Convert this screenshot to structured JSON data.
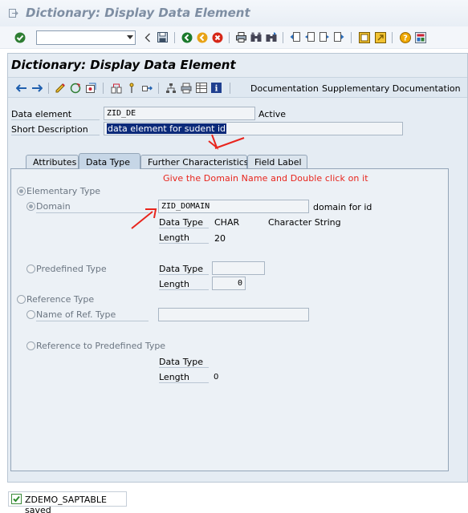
{
  "window": {
    "title": "Dictionary: Display Data Element"
  },
  "toolbar": {
    "command_field": {
      "value": "",
      "placeholder": ""
    },
    "icons": [
      "enter-icon",
      "back-icon",
      "save-icon",
      "green-back-icon",
      "exit-icon",
      "cancel-icon",
      "print-icon",
      "find-icon",
      "find-next-icon",
      "first-page-icon",
      "prev-page-icon",
      "next-page-icon",
      "last-page-icon",
      "new-session-icon",
      "shortcut-icon",
      "help-icon",
      "layout-icon"
    ]
  },
  "screen": {
    "title": "Dictionary: Display Data Element",
    "app_toolbar": {
      "documentation": "Documentation",
      "supplementary": "Supplementary Documentation"
    }
  },
  "header": {
    "data_element_label": "Data element",
    "data_element_value": "ZID_DE",
    "status": "Active",
    "short_desc_label": "Short Description",
    "short_desc_value": "data element for sudent id"
  },
  "tabs": [
    {
      "label": "Attributes",
      "active": false
    },
    {
      "label": "Data Type",
      "active": true
    },
    {
      "label": "Further Characteristics",
      "active": false
    },
    {
      "label": "Field Label",
      "active": false
    }
  ],
  "annotation": {
    "hint": "Give the Domain Name and Double click on it",
    "color": "#e8241c"
  },
  "data_type": {
    "elementary": "Elementary Type",
    "domain_label": "Domain",
    "domain_value": "ZID_DOMAIN",
    "domain_desc": "domain for id",
    "dt_label": "Data Type",
    "dt_value": "CHAR",
    "dt_desc": "Character String",
    "len_label": "Length",
    "len_value": "20",
    "predefined": "Predefined Type",
    "pre_dt_label": "Data Type",
    "pre_dt_value": "",
    "pre_len_label": "Length",
    "pre_len_value": "0",
    "reference": "Reference Type",
    "ref_name": "Name of Ref. Type",
    "ref_name_value": "",
    "ref_predef": "Reference to Predefined Type",
    "ref_dt_label": "Data Type",
    "ref_len_label": "Length",
    "ref_len_value": "0"
  },
  "status_bar": {
    "message": "ZDEMO_SAPTABLE saved"
  }
}
